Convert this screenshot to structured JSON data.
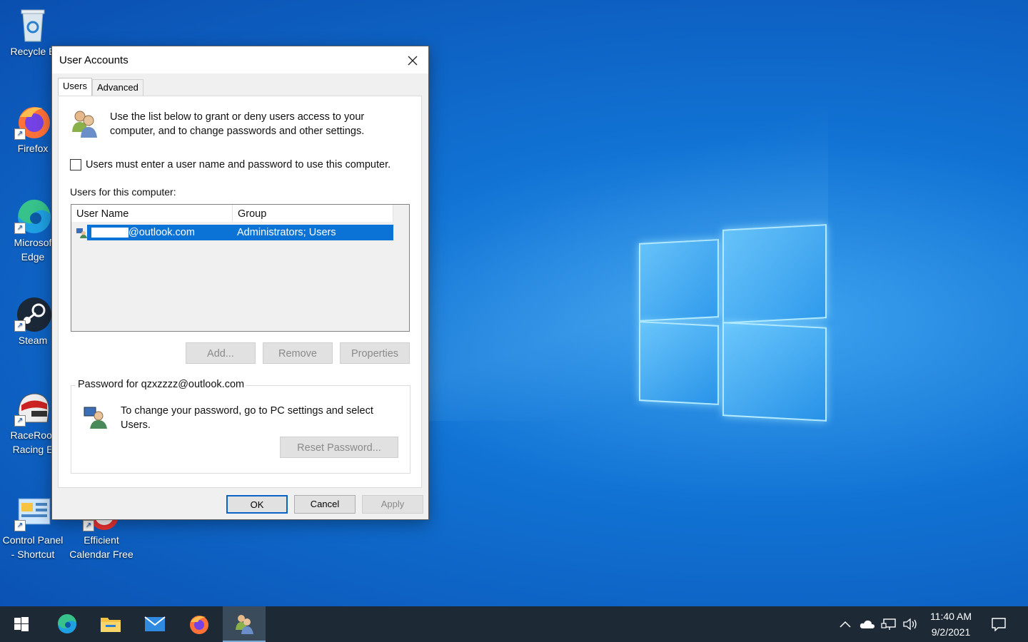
{
  "desktop": {
    "icons": [
      {
        "label": "Recycle B"
      },
      {
        "label": "Firefox"
      },
      {
        "label": "Microsof\nEdge"
      },
      {
        "label": "Steam"
      },
      {
        "label": "RaceRoor\nRacing E"
      },
      {
        "label": "Control Panel\n- Shortcut"
      },
      {
        "label": "Efficient\nCalendar Free"
      }
    ]
  },
  "dialog": {
    "title": "User Accounts",
    "tabs": [
      {
        "label": "Users"
      },
      {
        "label": "Advanced"
      }
    ],
    "intro": "Use the list below to grant or deny users access to your computer, and to change passwords and other settings.",
    "checkbox_label": "Users must enter a user name and password to use this computer.",
    "checkbox_checked": false,
    "users_label": "Users for this computer:",
    "columns": [
      "User Name",
      "Group"
    ],
    "rows": [
      {
        "user_suffix": "@outlook.com",
        "group": "Administrators; Users"
      }
    ],
    "buttons": {
      "add": "Add...",
      "remove": "Remove",
      "properties": "Properties"
    },
    "password_legend": "Password for qzxzzzz@outlook.com",
    "password_text": "To change your password, go to PC settings and select Users.",
    "reset_password": "Reset Password...",
    "ok": "OK",
    "cancel": "Cancel",
    "apply": "Apply"
  },
  "taskbar": {
    "apps": [
      "windows-start",
      "edge",
      "file-explorer",
      "mail",
      "firefox",
      "user-accounts"
    ],
    "time": "11:40 AM",
    "date": "9/2/2021"
  },
  "colors": {
    "selection": "#0c73d6",
    "taskbar": "#1d2a36"
  }
}
